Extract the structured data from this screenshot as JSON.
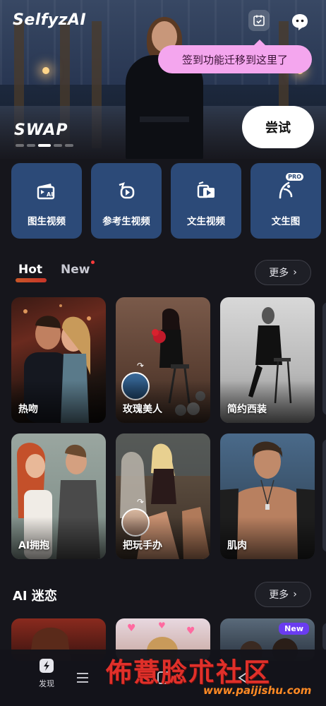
{
  "header": {
    "logo": "SelfyzAI",
    "checkin_tooltip": "签到功能迁移到这里了"
  },
  "hero": {
    "banner_label": "SWAP",
    "try_button": "尝试",
    "carousel_page": 3,
    "carousel_total": 5
  },
  "features": [
    {
      "label": "图生视频",
      "icon": "image-to-video-icon"
    },
    {
      "label": "参考生视频",
      "icon": "reference-video-icon"
    },
    {
      "label": "文生视频",
      "icon": "text-to-video-icon"
    },
    {
      "label": "文生图",
      "icon": "text-to-image-icon",
      "badge": "PRO"
    }
  ],
  "tabs": [
    {
      "label": "Hot",
      "active": true
    },
    {
      "label": "New",
      "active": false,
      "has_dot": true
    }
  ],
  "more_label": "更多",
  "hot_cards_row1": [
    {
      "caption": "热吻"
    },
    {
      "caption": "玫瑰美人"
    },
    {
      "caption": "简约西装"
    }
  ],
  "hot_cards_row2": [
    {
      "caption": "AI拥抱"
    },
    {
      "caption": "把玩手办"
    },
    {
      "caption": "肌肉"
    }
  ],
  "section2": {
    "title": "AI 迷恋",
    "new_badge": "New"
  },
  "bottom_nav": {
    "discover": "发现"
  },
  "watermark": {
    "text": "佈薏腍朮社区",
    "url": "www.paijishu.com"
  },
  "colors": {
    "tile_bg": "#2c4a78",
    "tooltip_bg": "#f4a6ee",
    "page_bg": "#16161c",
    "tab_underline": "#e8612a",
    "new_badge": "#6a3cf0"
  }
}
